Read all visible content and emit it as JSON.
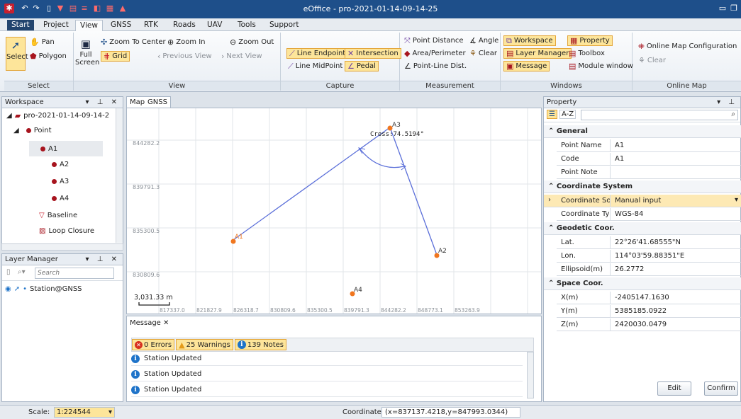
{
  "window": {
    "title": "eOffice - pro-2021-01-14-09-14-25"
  },
  "tabs": [
    "Start",
    "Project",
    "View",
    "GNSS",
    "RTK",
    "Roads",
    "UAV",
    "Tools",
    "Support"
  ],
  "ribbon": {
    "select_group": {
      "label": "Select",
      "select": "Select",
      "pan": "Pan",
      "polygon": "Polygon"
    },
    "view_group": {
      "label": "View",
      "full_screen": "Full Screen",
      "zoom_to_center": "Zoom To Center",
      "zoom_in": "Zoom In",
      "zoom_out": "Zoom Out",
      "grid": "Grid",
      "previous_view": "Previous View",
      "next_view": "Next View"
    },
    "capture_group": {
      "label": "Capture",
      "line_endpoint": "Line Endpoint",
      "intersection": "Intersection",
      "line_midpoint": "Line MidPoint",
      "pedal": "Pedal"
    },
    "measurement_group": {
      "label": "Measurement",
      "point_distance": "Point Distance",
      "angle": "Angle",
      "area_perimeter": "Area/Perimeter",
      "clear": "Clear",
      "point_line_dist": "Point-Line Dist."
    },
    "windows_group": {
      "label": "Windows",
      "workspace": "Workspace",
      "property": "Property",
      "layer_manager": "Layer Manager",
      "toolbox": "Toolbox",
      "message": "Message",
      "module_window": "Module window"
    },
    "online_map_group": {
      "label": "Online Map",
      "config": "Online Map Configuration",
      "clear": "Clear"
    }
  },
  "workspace": {
    "title": "Workspace",
    "project": "pro-2021-01-14-09-14-2",
    "point_folder": "Point",
    "points": [
      "A1",
      "A2",
      "A3",
      "A4"
    ],
    "baseline": "Baseline",
    "loop_closure": "Loop Closure"
  },
  "layer_manager": {
    "title": "Layer Manager",
    "search_placeholder": "Search",
    "layer": "Station@GNSS"
  },
  "map": {
    "tabs": [
      "Map",
      "GNSS"
    ],
    "y_ticks": [
      "844282.2",
      "839791.3",
      "835300.5",
      "830809.6"
    ],
    "x_ticks": [
      "817337.0",
      "821827.9",
      "826318.7",
      "830809.6",
      "835300.5",
      "839791.3",
      "844282.2",
      "848773.1",
      "853263.9"
    ],
    "scale_label": "3,031.33 m",
    "angle_label": "Cross:74.5194°",
    "points": [
      {
        "name": "A1"
      },
      {
        "name": "A2"
      },
      {
        "name": "A3"
      },
      {
        "name": "A4"
      }
    ]
  },
  "message": {
    "title": "Message",
    "errors": "0 Errors",
    "warnings": "25 Warnings",
    "notes": "139 Notes",
    "rows": [
      "Station Updated",
      "Station Updated",
      "Station Updated"
    ]
  },
  "property": {
    "title": "Property",
    "sort_az": "A-Z",
    "general": "General",
    "point_name_label": "Point Name",
    "point_name": "A1",
    "code_label": "Code",
    "code": "A1",
    "point_note_label": "Point Note",
    "point_note": "",
    "coord_system": "Coordinate System",
    "coord_source_label": "Coordinate Sour",
    "coord_source": "Manual input",
    "coord_type_label": "Coordinate Type",
    "coord_type": "WGS-84",
    "geodetic": "Geodetic Coor.",
    "lat_label": "Lat.",
    "lat": "22°26'41.68555\"N",
    "lon_label": "Lon.",
    "lon": "114°03'59.88351\"E",
    "ell_label": "Ellipsoid(m)",
    "ell": "26.2772",
    "space": "Space Coor.",
    "x_label": "X(m)",
    "x": "-2405147.1630",
    "y_label": "Y(m)",
    "y": "5385185.0922",
    "z_label": "Z(m)",
    "z": "2420030.0479",
    "edit": "Edit",
    "confirm": "Confirm"
  },
  "status": {
    "scale_label": "Scale:",
    "scale": "1:224544",
    "coord_label": "Coordinate:",
    "coord": "(x=837137.4218,y=847993.0344)"
  }
}
